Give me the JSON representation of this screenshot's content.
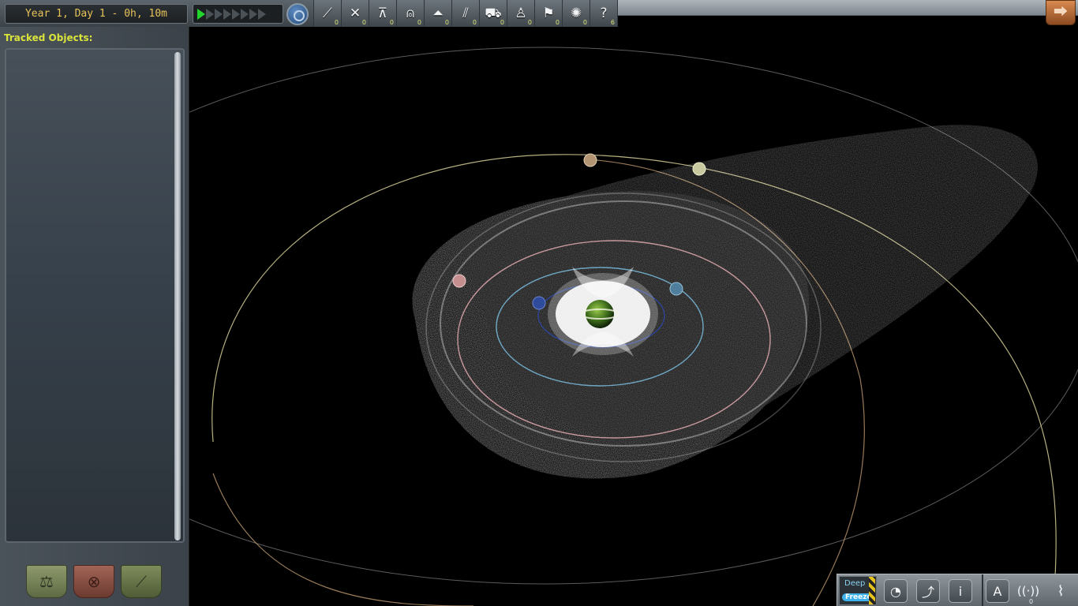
{
  "header": {
    "date": "Year 1, Day 1 - 0h, 10m",
    "warp_levels": 8,
    "warp_active": 1
  },
  "filters": [
    {
      "name": "debris",
      "icon": "debris-icon",
      "glyph": "⟋",
      "count": "0"
    },
    {
      "name": "probe",
      "icon": "probe-icon",
      "glyph": "✕",
      "count": "0"
    },
    {
      "name": "lander",
      "icon": "lander-icon",
      "glyph": "⊼",
      "count": "0"
    },
    {
      "name": "ship",
      "icon": "ship-icon",
      "glyph": "⍝",
      "count": "0"
    },
    {
      "name": "lander-science",
      "icon": "flask-icon",
      "glyph": "⏶",
      "count": "0"
    },
    {
      "name": "station",
      "icon": "station-icon",
      "glyph": "⫽",
      "count": "0"
    },
    {
      "name": "rover",
      "icon": "rover-icon",
      "glyph": "⛟",
      "count": "0"
    },
    {
      "name": "eva",
      "icon": "kerbal-icon",
      "glyph": "♙",
      "count": "0"
    },
    {
      "name": "flag",
      "icon": "flag-icon",
      "glyph": "⚑",
      "count": "0"
    },
    {
      "name": "asteroid",
      "icon": "asteroid-icon",
      "glyph": "✺",
      "count": "0"
    },
    {
      "name": "unknown",
      "icon": "question-icon",
      "glyph": "?",
      "count": "6"
    }
  ],
  "sidebar": {
    "title": "Tracked Objects:"
  },
  "apps": {
    "deep_label": "Deep",
    "freeze_label": "Freeze",
    "antenna_count": "0"
  },
  "colors": {
    "date_text": "#e7c258",
    "title_text": "#d9e33a",
    "warp_active": "#22d52a",
    "count_text": "#d7e27a"
  }
}
